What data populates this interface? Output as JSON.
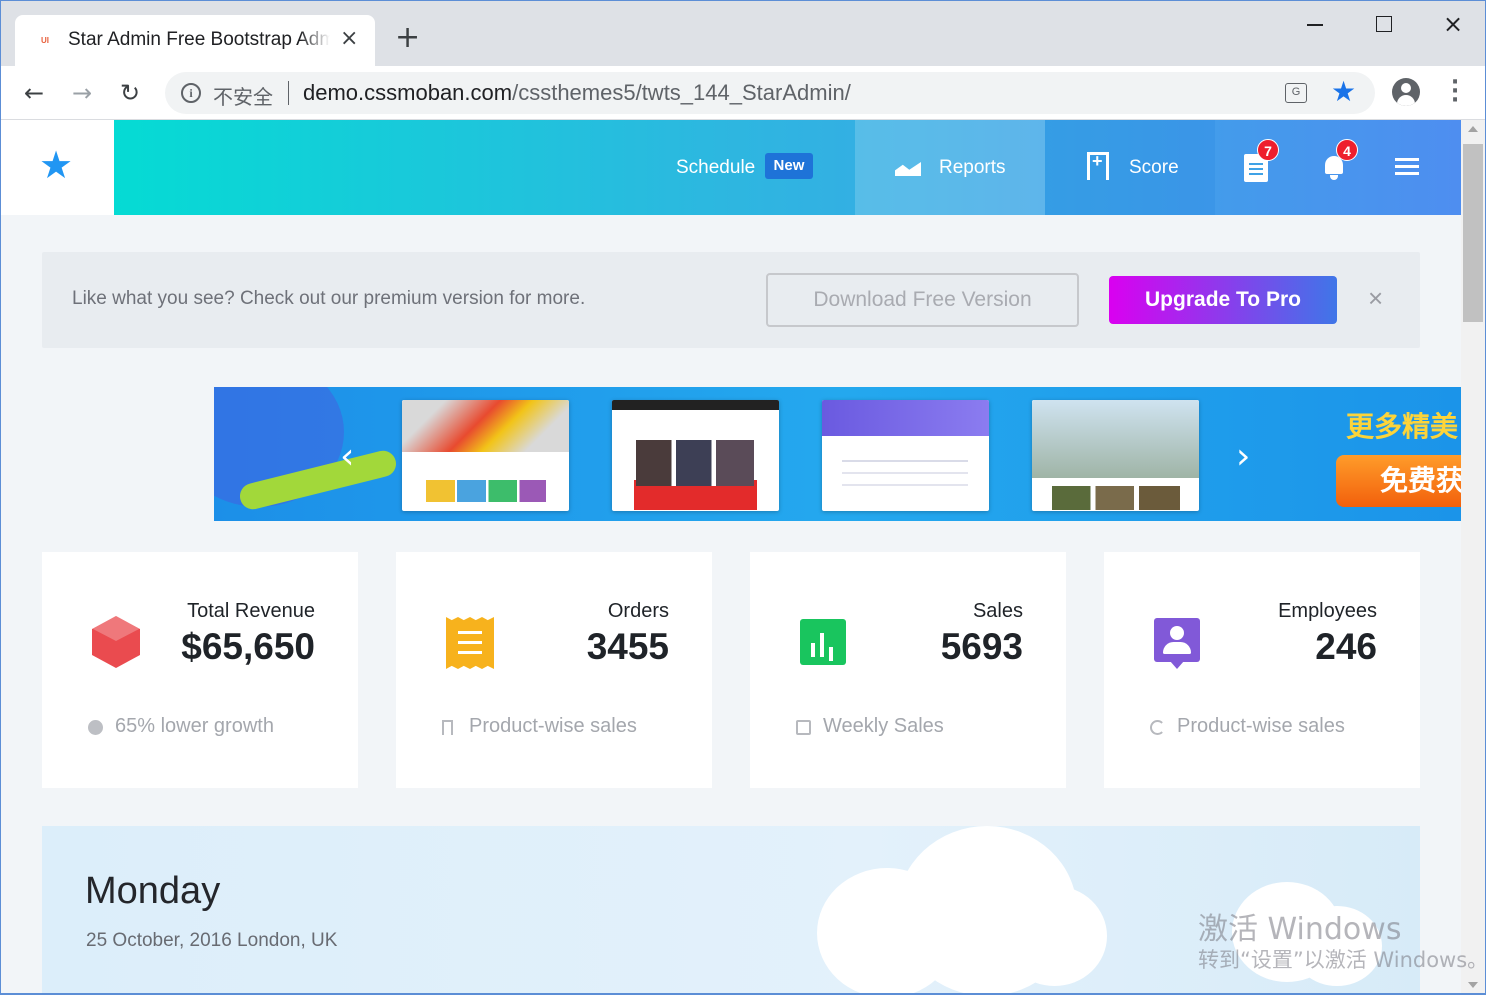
{
  "browser": {
    "tab": {
      "favicon": "UI",
      "title": "Star Admin Free Bootstrap Admin Template",
      "close": "×"
    },
    "new_tab": "+",
    "window": {
      "minimize": "",
      "maximize": "",
      "close": "×"
    },
    "nav": {
      "back": "←",
      "forward": "→",
      "reload": "↻"
    },
    "address": {
      "info": "i",
      "security_text": "不安全",
      "host": "demo.cssmoban.com",
      "path": "/cssthemes5/twts_144_StarAdmin/"
    },
    "translate": "G",
    "bookmark": "★",
    "menu": "⋮"
  },
  "navbar": {
    "brand_icon": "★",
    "schedule": {
      "label": "Schedule",
      "badge": "New"
    },
    "reports": {
      "label": "Reports"
    },
    "score": {
      "label": "Score"
    },
    "notes_count": "7",
    "notifications_count": "4"
  },
  "promo": {
    "text": "Like what you see? Check out our premium version for more.",
    "download_label": "Download Free Version",
    "upgrade_label": "Upgrade To Pro",
    "close": "×"
  },
  "banner": {
    "prev": "‹",
    "next": "›",
    "headline": "更多精美",
    "button": "免费获"
  },
  "stats": [
    {
      "label": "Total Revenue",
      "value": "$65,650",
      "footer": "65% lower growth",
      "icon": "cube-icon",
      "color": "#ea4b4f"
    },
    {
      "label": "Orders",
      "value": "3455",
      "footer": "Product-wise sales",
      "icon": "receipt-icon",
      "color": "#f7b21d"
    },
    {
      "label": "Sales",
      "value": "5693",
      "footer": "Weekly Sales",
      "icon": "bar-chart-icon",
      "color": "#19c55e"
    },
    {
      "label": "Employees",
      "value": "246",
      "footer": "Product-wise sales",
      "icon": "account-box-icon",
      "color": "#8159d8"
    }
  ],
  "weather": {
    "day": "Monday",
    "date": "25 October, 2016 London, UK"
  },
  "watermark": {
    "line1": "激活 Windows",
    "line2": "转到“设置”以激活 Windows。"
  },
  "colors": {
    "nav_gradient_start": "#05dbd4",
    "nav_gradient_end": "#4e8ef0",
    "upgrade_start": "#da00f0",
    "upgrade_end": "#3f76e8",
    "badge_red": "#ee1e2d",
    "brand_blue": "#2196f3"
  }
}
